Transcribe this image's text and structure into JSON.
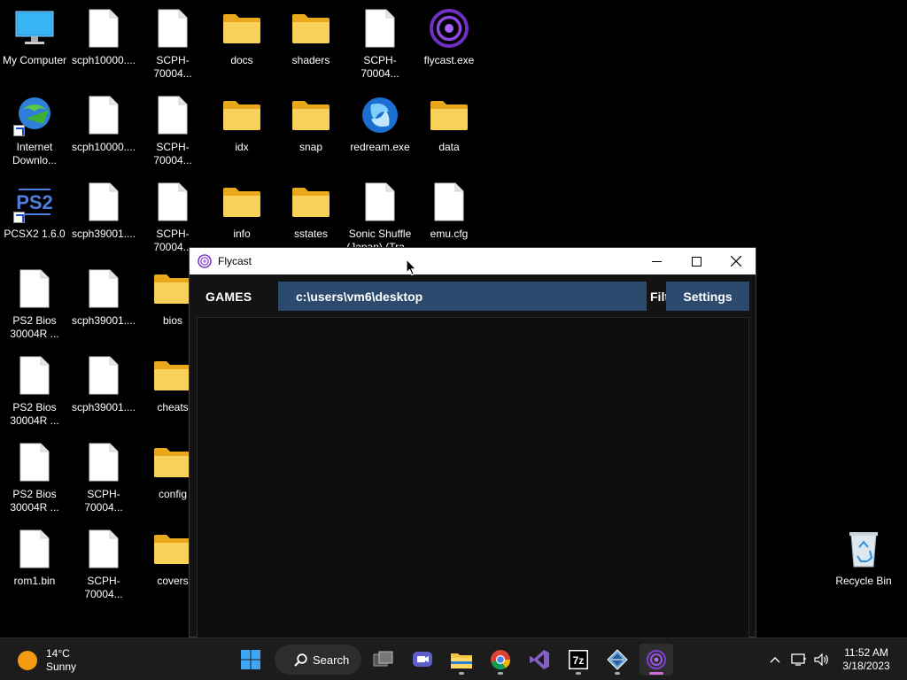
{
  "desktop": {
    "icons": [
      {
        "label": "My Computer",
        "icon": "computer-icon"
      },
      {
        "label": "scph10000....",
        "icon": "file-icon"
      },
      {
        "label": "SCPH-70004...",
        "icon": "file-icon"
      },
      {
        "label": "docs",
        "icon": "folder-icon"
      },
      {
        "label": "shaders",
        "icon": "folder-icon"
      },
      {
        "label": "SCPH-70004...",
        "icon": "file-icon"
      },
      {
        "label": "flycast.exe",
        "icon": "flycast-icon"
      },
      {
        "label": "Internet Downlo...",
        "icon": "idm-icon"
      },
      {
        "label": "scph10000....",
        "icon": "file-icon"
      },
      {
        "label": "SCPH-70004...",
        "icon": "file-icon"
      },
      {
        "label": "idx",
        "icon": "folder-icon"
      },
      {
        "label": "snap",
        "icon": "folder-icon"
      },
      {
        "label": "redream.exe",
        "icon": "redream-icon"
      },
      {
        "label": "data",
        "icon": "folder-icon"
      },
      {
        "label": "PCSX2 1.6.0",
        "icon": "pcsx2-icon"
      },
      {
        "label": "scph39001....",
        "icon": "file-icon"
      },
      {
        "label": "SCPH-70004...",
        "icon": "file-icon"
      },
      {
        "label": "info",
        "icon": "folder-icon"
      },
      {
        "label": "sstates",
        "icon": "folder-icon"
      },
      {
        "label": "Sonic Shuffle (Japan) (Tra...",
        "icon": "file-icon"
      },
      {
        "label": "emu.cfg",
        "icon": "file-icon"
      },
      {
        "label": "PS2 Bios 30004R ...",
        "icon": "file-icon"
      },
      {
        "label": "scph39001....",
        "icon": "file-icon"
      },
      {
        "label": "bios",
        "icon": "folder-icon"
      },
      {
        "label": "PS2 Bios 30004R ...",
        "icon": "file-icon"
      },
      {
        "label": "scph39001....",
        "icon": "file-icon"
      },
      {
        "label": "cheats",
        "icon": "folder-icon"
      },
      {
        "label": "PS2 Bios 30004R ...",
        "icon": "file-icon"
      },
      {
        "label": "SCPH-70004...",
        "icon": "file-icon"
      },
      {
        "label": "config",
        "icon": "folder-icon"
      },
      {
        "label": "rom1.bin",
        "icon": "file-icon"
      },
      {
        "label": "SCPH-70004...",
        "icon": "file-icon"
      },
      {
        "label": "covers",
        "icon": "folder-icon"
      },
      {
        "label": "Recycle Bin",
        "icon": "recycle-bin-icon"
      }
    ]
  },
  "window": {
    "title": "Flycast",
    "games_label": "GAMES",
    "path_value": "c:\\users\\vm6\\desktop",
    "filter_label": "Filter",
    "settings_label": "Settings"
  },
  "taskbar": {
    "weather_temp": "14°C",
    "weather_desc": "Sunny",
    "search_label": "Search",
    "time": "11:52 AM",
    "date": "3/18/2023"
  },
  "colors": {
    "accent": "#2c4a6e",
    "folder": "#f4c542",
    "taskbar_bg": "#1c1c1c"
  }
}
